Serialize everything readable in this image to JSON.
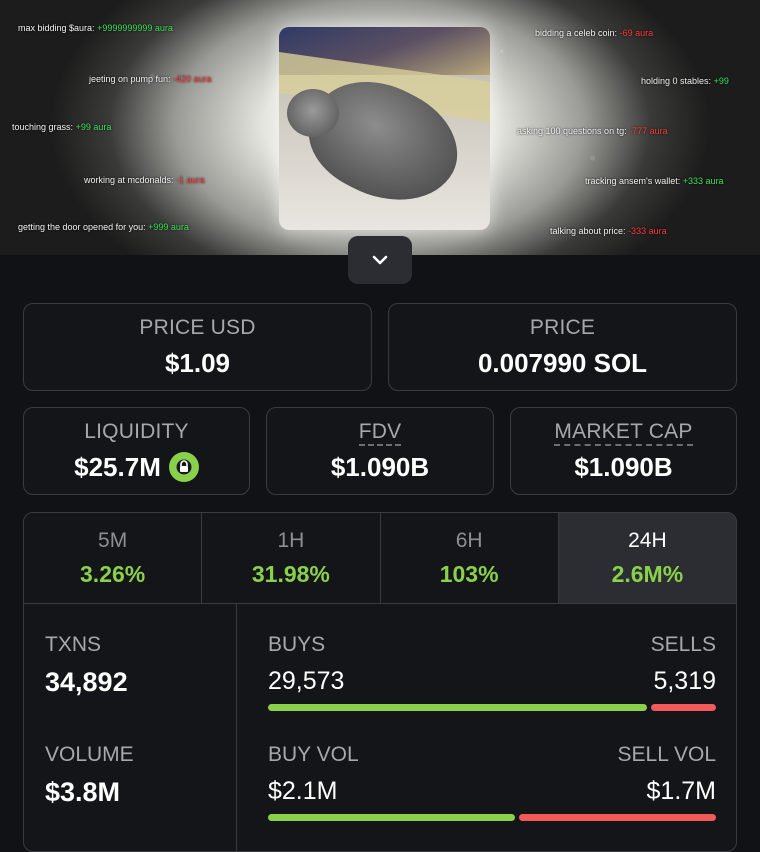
{
  "banner": {
    "aura_lines": [
      {
        "label": "max bidding $aura:",
        "value": "+9999999999 aura",
        "kind": "pos"
      },
      {
        "label": "jeeting on pump fun:",
        "value": "-420 aura",
        "kind": "neg"
      },
      {
        "label": "touching grass:",
        "value": "+99 aura",
        "kind": "pos"
      },
      {
        "label": "working at mcdonalds:",
        "value": "-1 aura",
        "kind": "neg"
      },
      {
        "label": "getting the door opened for you:",
        "value": "+999 aura",
        "kind": "pos"
      },
      {
        "label": "bidding a celeb coin:",
        "value": "-69 aura",
        "kind": "neg"
      },
      {
        "label": "holding 0 stables:",
        "value": "+99",
        "kind": "pos"
      },
      {
        "label": "asking 100 questions on tg:",
        "value": "-777 aura",
        "kind": "neg"
      },
      {
        "label": "tracking ansem's wallet:",
        "value": "+333 aura",
        "kind": "pos"
      },
      {
        "label": "talking about price:",
        "value": "-333 aura",
        "kind": "neg"
      }
    ]
  },
  "price_usd": {
    "label": "PRICE USD",
    "value": "$1.09"
  },
  "price_native": {
    "label": "PRICE",
    "value": "0.007990 SOL"
  },
  "liquidity": {
    "label": "LIQUIDITY",
    "value": "$25.7M"
  },
  "fdv": {
    "label": "FDV",
    "value": "$1.090B"
  },
  "market_cap": {
    "label": "MARKET CAP",
    "value": "$1.090B"
  },
  "timeframes": [
    {
      "label": "5M",
      "change": "3.26%"
    },
    {
      "label": "1H",
      "change": "31.98%"
    },
    {
      "label": "6H",
      "change": "103%"
    },
    {
      "label": "24H",
      "change": "2.6M%"
    }
  ],
  "active_timeframe": "24H",
  "txns": {
    "label": "TXNS",
    "value": "34,892"
  },
  "buys": {
    "label": "BUYS",
    "value": "29,573"
  },
  "sells": {
    "label": "SELLS",
    "value": "5,319"
  },
  "volume": {
    "label": "VOLUME",
    "value": "$3.8M"
  },
  "buy_vol": {
    "label": "BUY VOL",
    "value": "$2.1M"
  },
  "sell_vol": {
    "label": "SELL VOL",
    "value": "$1.7M"
  },
  "colors": {
    "positive": "#8ad14b",
    "negative": "#f25a5a",
    "background": "#111216"
  }
}
